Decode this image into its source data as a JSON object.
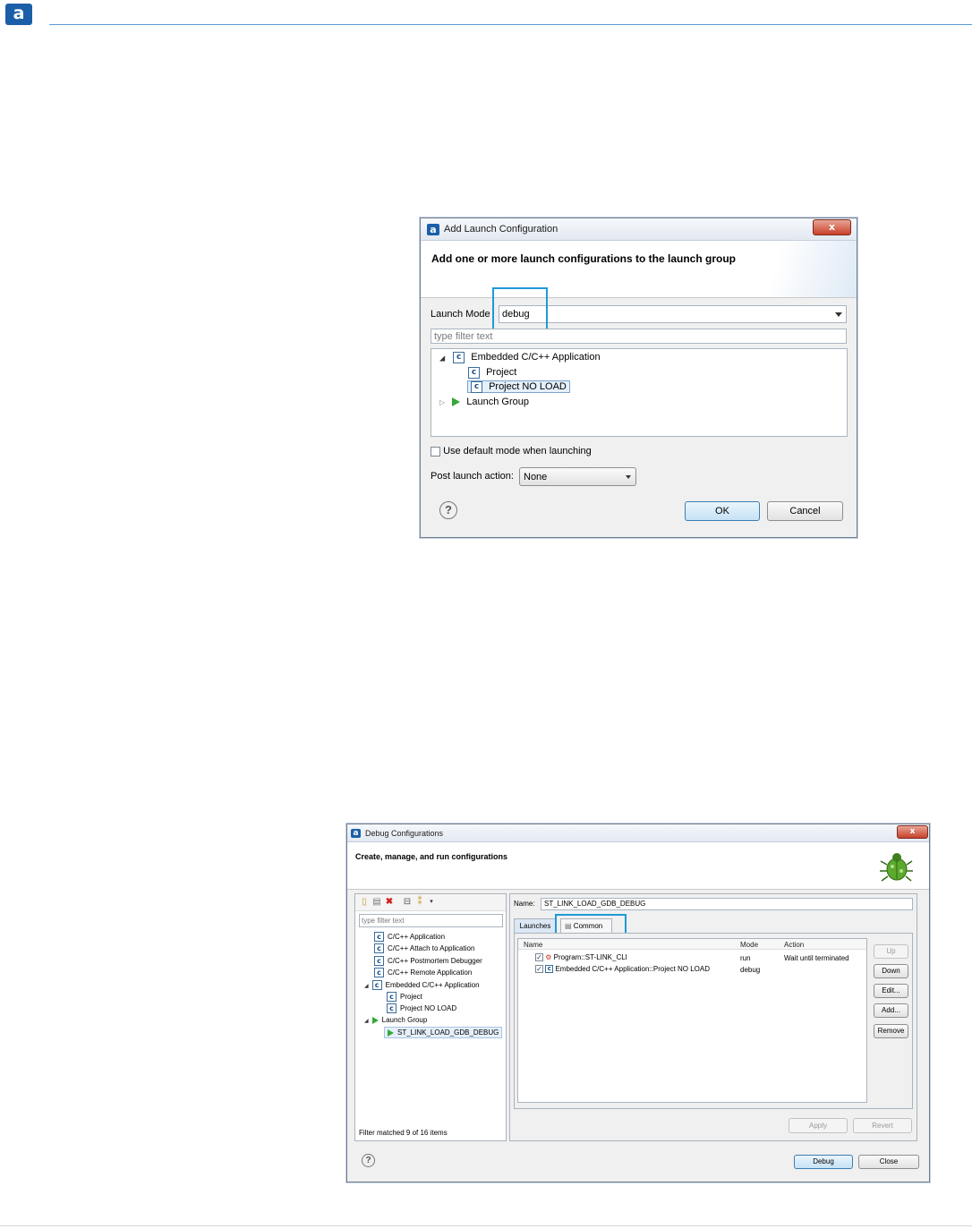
{
  "page": {
    "logo_letter": "a"
  },
  "dialog1": {
    "title": "Add Launch Configuration",
    "close_glyph": "x",
    "header": "Add one or more launch configurations to the launch group",
    "launch_mode_label": "Launch Mode",
    "launch_mode_value": "debug",
    "filter_placeholder": "type filter text",
    "tree": {
      "group1": "Embedded C/C++ Application",
      "item1": "Project",
      "item2": "Project NO LOAD",
      "group2": "Launch Group"
    },
    "use_default_label": "Use default mode when launching",
    "post_launch_label": "Post launch action:",
    "post_launch_value": "None",
    "ok_label": "OK",
    "cancel_label": "Cancel",
    "help_glyph": "?"
  },
  "dialog2": {
    "title": "Debug Configurations",
    "close_glyph": "x",
    "header": "Create, manage, and run configurations",
    "filter_placeholder": "type filter text",
    "tree": [
      "C/C++ Application",
      "C/C++ Attach to Application",
      "C/C++ Postmortem Debugger",
      "C/C++ Remote Application",
      "Embedded C/C++ Application",
      "Project",
      "Project NO LOAD",
      "Launch Group",
      "ST_LINK_LOAD_GDB_DEBUG"
    ],
    "filter_status": "Filter matched 9 of 16 items",
    "name_label": "Name:",
    "name_value": "ST_LINK_LOAD_GDB_DEBUG",
    "tab_launches": "Launches",
    "tab_common": "Common",
    "columns": [
      "Name",
      "Mode",
      "Action"
    ],
    "rows": [
      {
        "name": "Program::ST-LINK_CLI",
        "mode": "run",
        "action": "Wait until terminated"
      },
      {
        "name": "Embedded C/C++ Application::Project NO LOAD",
        "mode": "debug",
        "action": ""
      }
    ],
    "buttons": {
      "up": "Up",
      "down": "Down",
      "edit": "Edit...",
      "add": "Add...",
      "remove": "Remove",
      "apply": "Apply",
      "revert": "Revert",
      "debug": "Debug",
      "close": "Close"
    },
    "help_glyph": "?"
  }
}
